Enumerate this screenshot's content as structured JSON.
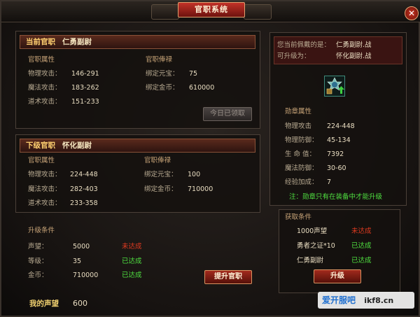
{
  "window": {
    "title": "官职系统",
    "close_label": "✕"
  },
  "current": {
    "header_label": "当前官职",
    "header_value": "仁勇副尉",
    "attr_title": "官职属性",
    "salary_title": "官职俸禄",
    "attrs": [
      {
        "label": "物理攻击：",
        "value": "146-291"
      },
      {
        "label": "魔法攻击：",
        "value": "183-262"
      },
      {
        "label": "道术攻击：",
        "value": "151-233"
      }
    ],
    "salary": [
      {
        "label": "绑定元宝：",
        "value": "75"
      },
      {
        "label": "绑定金币：",
        "value": "610000"
      }
    ],
    "claim_button": "今日已领取"
  },
  "next": {
    "header_label": "下级官职",
    "header_value": "怀化副尉",
    "attr_title": "官职属性",
    "salary_title": "官职俸禄",
    "attrs": [
      {
        "label": "物理攻击：",
        "value": "224-448"
      },
      {
        "label": "魔法攻击：",
        "value": "282-403"
      },
      {
        "label": "道术攻击：",
        "value": "233-358"
      }
    ],
    "salary": [
      {
        "label": "绑定元宝：",
        "value": "100"
      },
      {
        "label": "绑定金币：",
        "value": "710000"
      }
    ]
  },
  "upgrade_conditions": {
    "title": "升级条件",
    "rows": [
      {
        "label": "声望：",
        "value": "5000",
        "status": "未达成"
      },
      {
        "label": "等级：",
        "value": "35",
        "status": "已达成"
      },
      {
        "label": "金币：",
        "value": "710000",
        "status": "已达成"
      }
    ],
    "button": "提升官职",
    "status_colors": {
      "未达成": "#e03a20",
      "已达成": "#4fe040"
    }
  },
  "prestige": {
    "label": "我的声望",
    "value": "600"
  },
  "medal": {
    "wearing_label": "您当前佩戴的是：",
    "wearing_value": "仁勇副尉.战",
    "upgradable_label": "可升级为：",
    "upgradable_value": "怀化副尉.战",
    "icon": "medal-icon",
    "attr_title": "勋章属性",
    "attrs": [
      {
        "label": "物理攻击",
        "value": "224-448"
      },
      {
        "label": "物理防御：",
        "value": "45-134"
      },
      {
        "label": "生 命 值：",
        "value": "7392"
      },
      {
        "label": "魔法防御：",
        "value": "30-60"
      },
      {
        "label": "经验加成：",
        "value": "7"
      }
    ],
    "note": "注：勋章只有在装备中才能升级"
  },
  "obtain": {
    "title": "获取条件",
    "rows": [
      {
        "item": "1000声望",
        "status": "未达成"
      },
      {
        "item": "勇者之证*10",
        "status": "已达成"
      },
      {
        "item": "仁勇副尉",
        "status": "已达成"
      }
    ],
    "button": "升级"
  },
  "watermark": {
    "text": "爱开服吧",
    "domain": "ikf8.cn"
  },
  "colors": {
    "accent_red": "#a22a1d",
    "label_tan": "#c8a478",
    "ok_green": "#4fe040",
    "fail_red": "#e03a20"
  }
}
